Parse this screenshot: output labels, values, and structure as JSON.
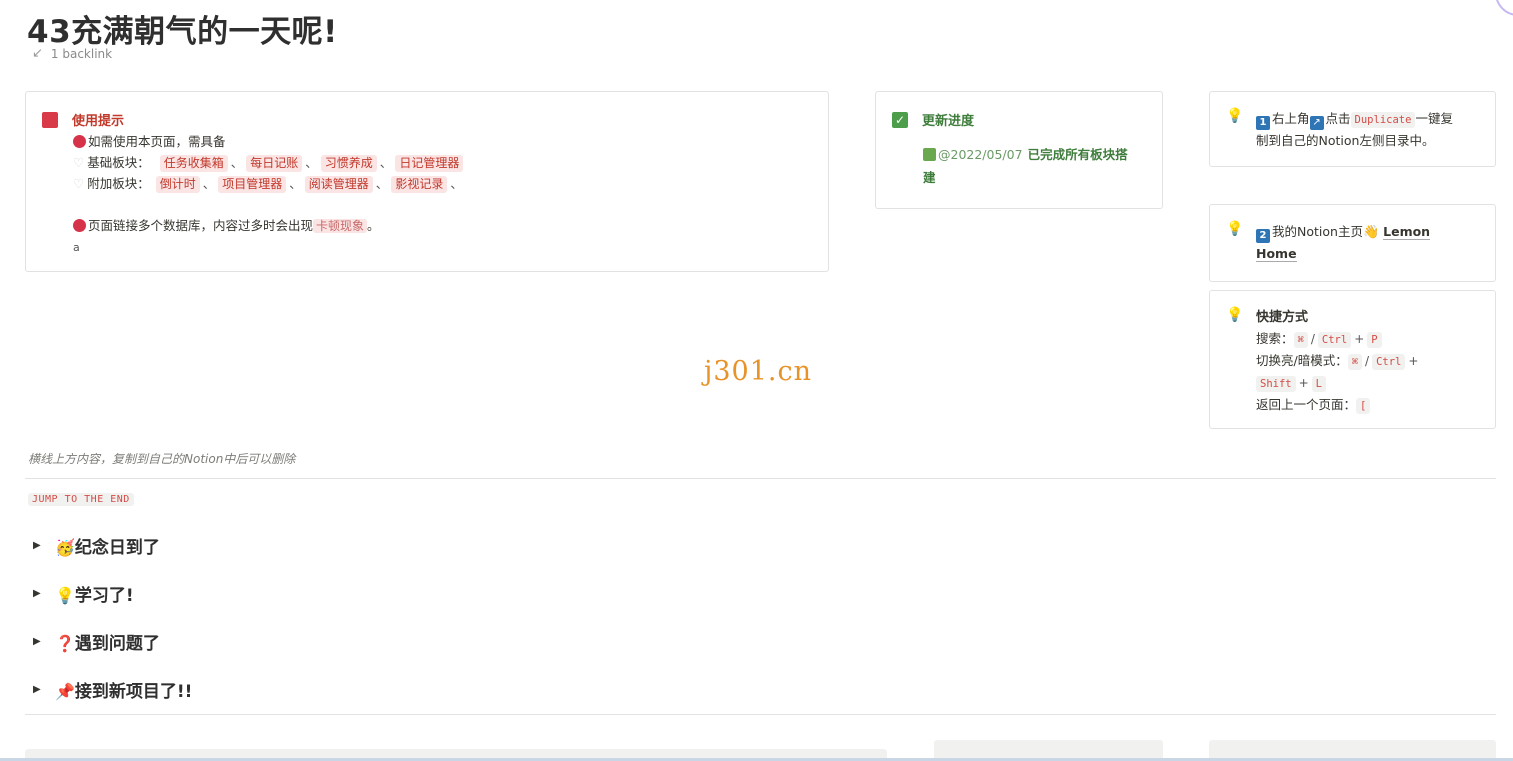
{
  "page": {
    "title": "43充满朝气的一天呢!",
    "backlink": "1 backlink"
  },
  "tips_card": {
    "header": "使用提示",
    "line1": "如需使用本页面，需具备",
    "base_label": "基础板块：",
    "base_tags": [
      "任务收集箱",
      "每日记账",
      "习惯养成",
      "日记管理器"
    ],
    "extra_label": "附加板块：",
    "extra_tags": [
      "倒计时",
      "项目管理器",
      "阅读管理器",
      "影视记录"
    ],
    "sep": "、",
    "line3_prefix": "页面链接多个数据库，内容过多时会出现",
    "line3_tag": "卡顿现象",
    "line3_suffix": "。",
    "small_a": "a"
  },
  "progress_card": {
    "header": "更新进度",
    "date": "@2022/05/07",
    "done_text_1": "已完成所有板块搭",
    "done_text_2": "建"
  },
  "callout1": {
    "num": "1",
    "text1": "右上角",
    "text2": "点击",
    "code": "Duplicate",
    "text3": "一键复",
    "text4": "制到自己的Notion左侧目录中。"
  },
  "callout2": {
    "num": "2",
    "text1": "我的Notion主页",
    "link1": "Lemon",
    "link2": "Home"
  },
  "callout3": {
    "header": "快捷方式",
    "search_label": "搜索：",
    "theme_label": "切换亮/暗模式：",
    "back_label": "返回上一个页面：",
    "keys": {
      "cmd": "⌘",
      "ctrl": "Ctrl",
      "p": "P",
      "shift": "Shift",
      "l": "L",
      "bracket": "["
    },
    "slash": "/",
    "plus": "+"
  },
  "watermark": "j301.cn",
  "note": "横线上方内容，复制到自己的Notion中后可以删除",
  "jump_label": "JUMP TO THE END",
  "toggles": [
    {
      "emoji": "🥳",
      "label": "纪念日到了"
    },
    {
      "emoji": "💡",
      "label": "学习了!"
    },
    {
      "emoji": "❓",
      "label": "遇到问题了"
    },
    {
      "emoji": "📌",
      "label": "接到新项目了!!"
    }
  ],
  "icons": {
    "toggle": "▶",
    "heart": "♡",
    "check": "✓",
    "bulb": "💡",
    "backlink_arrow": "↙",
    "external": "↗",
    "hand": "👋"
  },
  "colors": {
    "accent_red": "#d83a4a",
    "accent_green": "#4d9e4a",
    "watermark": "#e8932a",
    "link_blue": "#2e75b6"
  }
}
